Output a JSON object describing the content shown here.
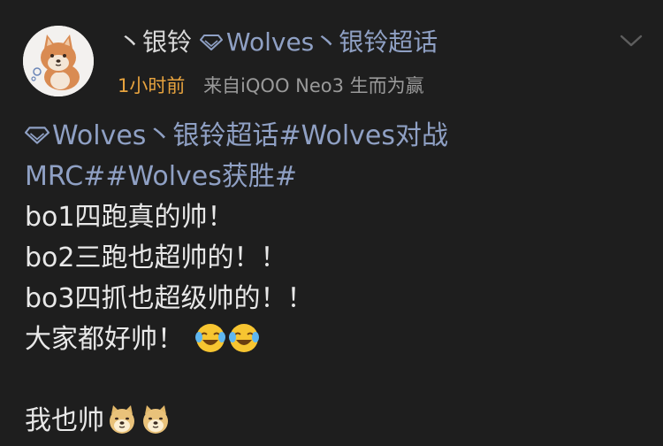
{
  "post": {
    "username_prefix": "丶银铃",
    "username_topic": "Wolves丶银铃超话",
    "time": "1小时前",
    "source": "来自iQOO Neo3 生而为赢",
    "icons": {
      "topic": "diamond-icon",
      "more": "chevron-down-icon",
      "avatar": "shiba-avatar"
    },
    "colors": {
      "link": "#8fa0c4",
      "time": "#e7a33e",
      "source": "#9a9a9a",
      "background": "#1e1e1e"
    }
  },
  "content": {
    "line1_topic": "Wolves丶银铃超话",
    "line1_tag": "#Wolves对战",
    "line2_tag": "MRC##Wolves获胜#",
    "line3": "bo1四跑真的帅！",
    "line4": "bo2三跑也超帅的！！",
    "line5": "bo3四抓也超级帅的！！",
    "line6": "大家都好帅！",
    "line6_emojis": [
      "tearful-laugh-emoji",
      "tearful-laugh-emoji"
    ],
    "line8": "我也帅",
    "line8_emojis": [
      "doge-emoji",
      "doge-emoji"
    ]
  }
}
